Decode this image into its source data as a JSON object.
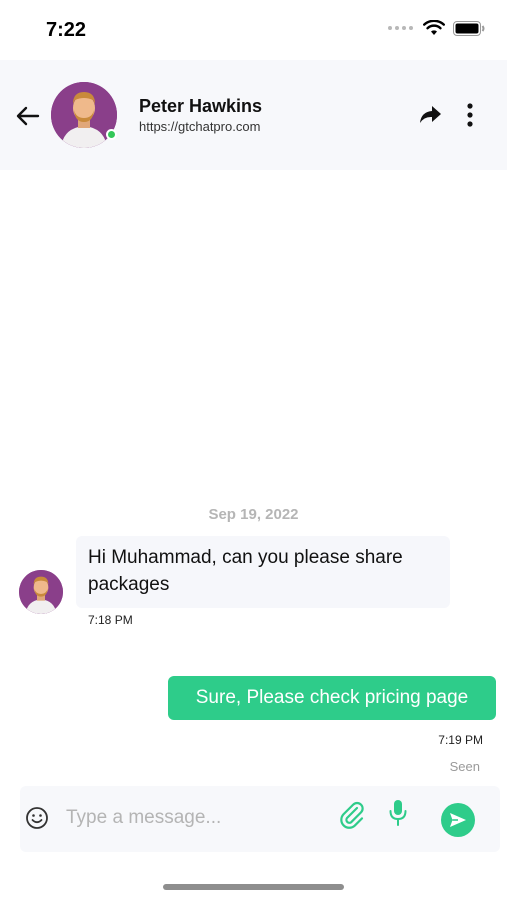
{
  "status_bar": {
    "time": "7:22"
  },
  "header": {
    "contact_name": "Peter Hawkins",
    "contact_url": "https://gtchatpro.com",
    "online": true
  },
  "conversation": {
    "date_separator": "Sep 19, 2022",
    "messages": [
      {
        "direction": "incoming",
        "text": "Hi Muhammad, can you please share packages",
        "time": "7:18 PM"
      },
      {
        "direction": "outgoing",
        "text": "Sure, Please check pricing page",
        "time": "7:19 PM",
        "status": "Seen"
      }
    ]
  },
  "composer": {
    "placeholder": "Type a message...",
    "value": ""
  },
  "colors": {
    "accent": "#2ecc8a",
    "online": "#34c759",
    "header_bg": "#f7f8fb",
    "avatar_bg": "#8a3f8a"
  },
  "icons": {
    "back": "arrow-left-icon",
    "share": "share-arrow-icon",
    "more": "more-vertical-icon",
    "emoji": "emoji-icon",
    "attach": "paperclip-icon",
    "mic": "microphone-icon",
    "send": "send-icon"
  }
}
